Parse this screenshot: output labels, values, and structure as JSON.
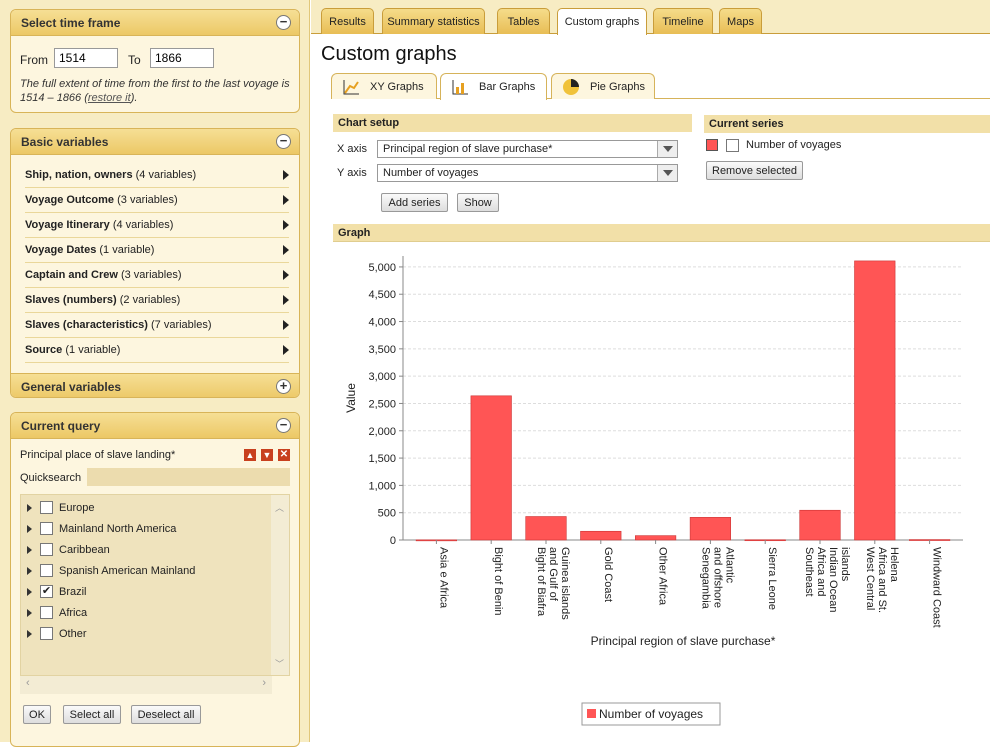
{
  "time_frame": {
    "title": "Select time frame",
    "from_label": "From",
    "from_value": "1514",
    "to_label": "To",
    "to_value": "1866",
    "note": "The full extent of time from the first to the last voyage is 1514 – 1866 (",
    "restore_link": "restore it",
    "note_end": ")."
  },
  "basic": {
    "title": "Basic variables",
    "items": [
      {
        "label": "Ship, nation, owners",
        "count": "(4 variables)"
      },
      {
        "label": "Voyage Outcome",
        "count": "(3 variables)"
      },
      {
        "label": "Voyage Itinerary",
        "count": "(4 variables)"
      },
      {
        "label": "Voyage Dates",
        "count": "(1 variable)"
      },
      {
        "label": "Captain and Crew",
        "count": "(3 variables)"
      },
      {
        "label": "Slaves (numbers)",
        "count": "(2 variables)"
      },
      {
        "label": "Slaves (characteristics)",
        "count": "(7 variables)"
      },
      {
        "label": "Source",
        "count": "(1 variable)"
      }
    ]
  },
  "general": {
    "title": "General variables"
  },
  "query": {
    "title": "Current query",
    "field": "Principal place of slave landing*",
    "quicksearch_label": "Quicksearch",
    "quicksearch_value": "",
    "regions": [
      {
        "label": "Europe",
        "checked": false
      },
      {
        "label": "Mainland North America",
        "checked": false
      },
      {
        "label": "Caribbean",
        "checked": false
      },
      {
        "label": "Spanish American Mainland",
        "checked": false
      },
      {
        "label": "Brazil",
        "checked": true
      },
      {
        "label": "Africa",
        "checked": false
      },
      {
        "label": "Other",
        "checked": false
      }
    ],
    "ok_label": "OK",
    "select_all_label": "Select all",
    "deselect_all_label": "Deselect all"
  },
  "tabs": [
    "Results",
    "Summary statistics",
    "Tables",
    "Custom graphs",
    "Timeline",
    "Maps"
  ],
  "active_tab": "Custom graphs",
  "page_title": "Custom graphs",
  "subtabs": [
    "XY Graphs",
    "Bar Graphs",
    "Pie Graphs"
  ],
  "active_subtab": "Bar Graphs",
  "chart_setup": {
    "title": "Chart setup",
    "x_label": "X axis",
    "x_value": "Principal region of slave purchase*",
    "y_label": "Y axis",
    "y_value": "Number of voyages",
    "add_label": "Add series",
    "show_label": "Show"
  },
  "current_series": {
    "title": "Current series",
    "series_label": "Number of voyages",
    "remove_label": "Remove selected"
  },
  "graph_title": "Graph",
  "colors": {
    "bar": "#ff5555",
    "accent": "#ecc866",
    "panel": "#fdf6df"
  },
  "chart_data": {
    "type": "bar",
    "categories": [
      "Asia e Africa",
      "Bight of Benin",
      "Bight of Biafra and Gulf of Guinea islands",
      "Gold Coast",
      "Other Africa",
      "Senegambia and offshore Atlantic",
      "Sierra Leone",
      "Southeast Africa and Indian Ocean islands",
      "West Central Africa and St. Helena",
      "Windward Coast"
    ],
    "category_lines": [
      [
        "Asia e Africa"
      ],
      [
        "Bight of Benin"
      ],
      [
        "Bight of Biafra",
        "and Gulf of",
        "Guinea islands"
      ],
      [
        "Gold Coast"
      ],
      [
        "Other Africa"
      ],
      [
        "Senegambia",
        "and offshore",
        "Atlantic"
      ],
      [
        "Sierra Leone"
      ],
      [
        "Southeast",
        "Africa and",
        "Indian Ocean",
        "islands"
      ],
      [
        "West Central",
        "Africa and St.",
        "Helena"
      ],
      [
        "Windward Coast"
      ]
    ],
    "series": [
      {
        "name": "Number of voyages",
        "values": [
          3,
          2640,
          430,
          160,
          80,
          415,
          5,
          545,
          5110,
          8
        ]
      }
    ],
    "xlabel": "Principal region of slave purchase*",
    "ylabel": "Value",
    "ylim": [
      0,
      5200
    ],
    "yticks": [
      0,
      500,
      1000,
      1500,
      2000,
      2500,
      3000,
      3500,
      4000,
      4500,
      5000
    ],
    "ytick_labels": [
      "0",
      "500",
      "1,000",
      "1,500",
      "2,000",
      "2,500",
      "3,000",
      "3,500",
      "4,000",
      "4,500",
      "5,000"
    ],
    "grid": true,
    "legend": "bottom"
  }
}
